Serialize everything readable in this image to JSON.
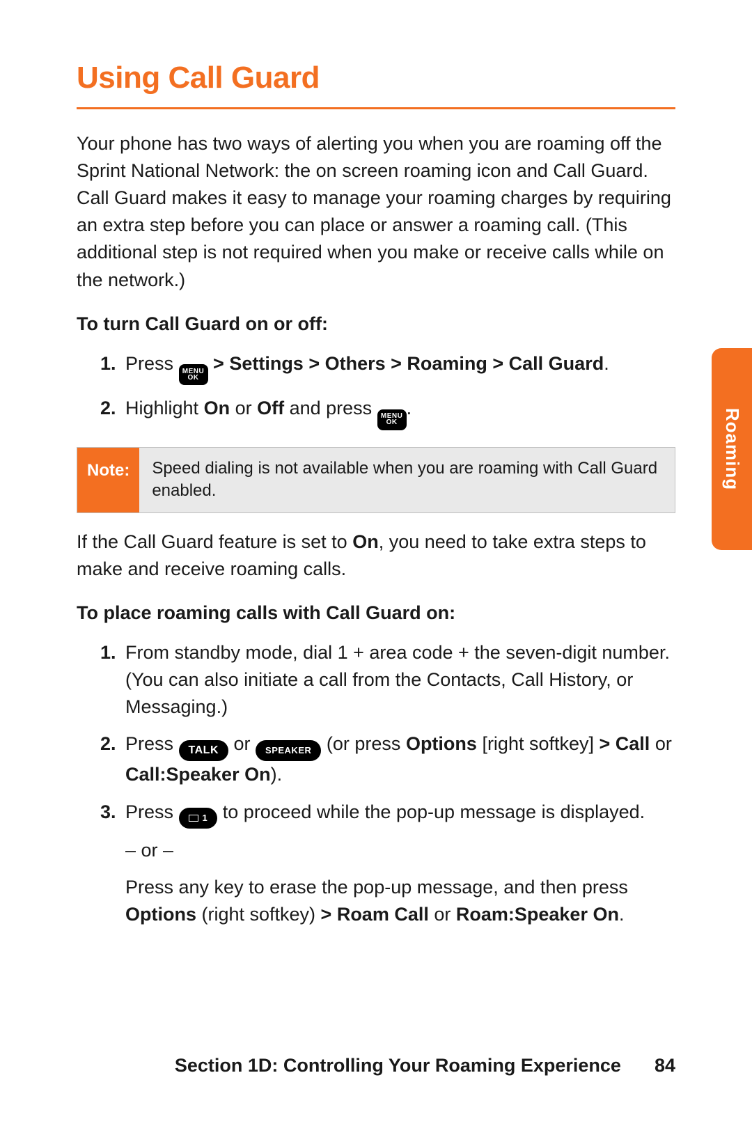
{
  "title": "Using Call Guard",
  "intro": "Your phone has two ways of alerting you when you are roaming off the Sprint National Network: the on screen roaming icon and Call Guard. Call Guard makes it easy to manage your roaming charges by requiring an extra step before you can place or answer a roaming call. (This additional step is not required when you make or receive calls while on the network.)",
  "sub1": "To turn Call Guard on or off:",
  "step1_1_a": "Press ",
  "step1_1_b": " > Settings > Others > Roaming > Call Guard",
  "step1_2_a": "Highlight ",
  "step1_2_on": "On",
  "step1_2_mid": " or ",
  "step1_2_off": "Off",
  "step1_2_b": " and press ",
  "menu_key_top": "MENU",
  "menu_key_bot": "OK",
  "note_label": "Note:",
  "note_text": "Speed dialing is not available when you are roaming with Call Guard enabled.",
  "after_note_a": "If the Call Guard feature is set to ",
  "after_note_on": "On",
  "after_note_b": ", you need to take extra steps to make and receive roaming calls.",
  "sub2": "To place roaming calls with Call Guard on:",
  "step2_1": "From standby mode, dial 1 + area code + the seven-digit number. (You can also initiate a call from the Contacts, Call History, or Messaging.)",
  "step2_2_a": "Press ",
  "talk_label": "TALK",
  "step2_2_b": " or ",
  "speaker_label": "SPEAKER",
  "step2_2_c": " (or press ",
  "step2_2_opt": "Options",
  "step2_2_d": " [right softkey] ",
  "step2_2_e": "> Call",
  "step2_2_f": " or ",
  "step2_2_g": "Call:Speaker On",
  "step2_2_h": ").",
  "step2_3_a": "Press ",
  "mail1_label": "1",
  "step2_3_b": " to proceed while the pop-up message is displayed.",
  "or_text": "– or –",
  "step2_3_c": "Press any key to erase the pop-up message, and then press ",
  "step2_3_opt": "Options",
  "step2_3_d": " (right softkey) ",
  "step2_3_e": "> Roam Call",
  "step2_3_f": " or ",
  "step2_3_g": "Roam:Speaker On",
  "step2_3_h": ".",
  "side_tab": "Roaming",
  "footer_section": "Section 1D: Controlling Your Roaming Experience",
  "page_number": "84",
  "accent_color": "#f36f21"
}
